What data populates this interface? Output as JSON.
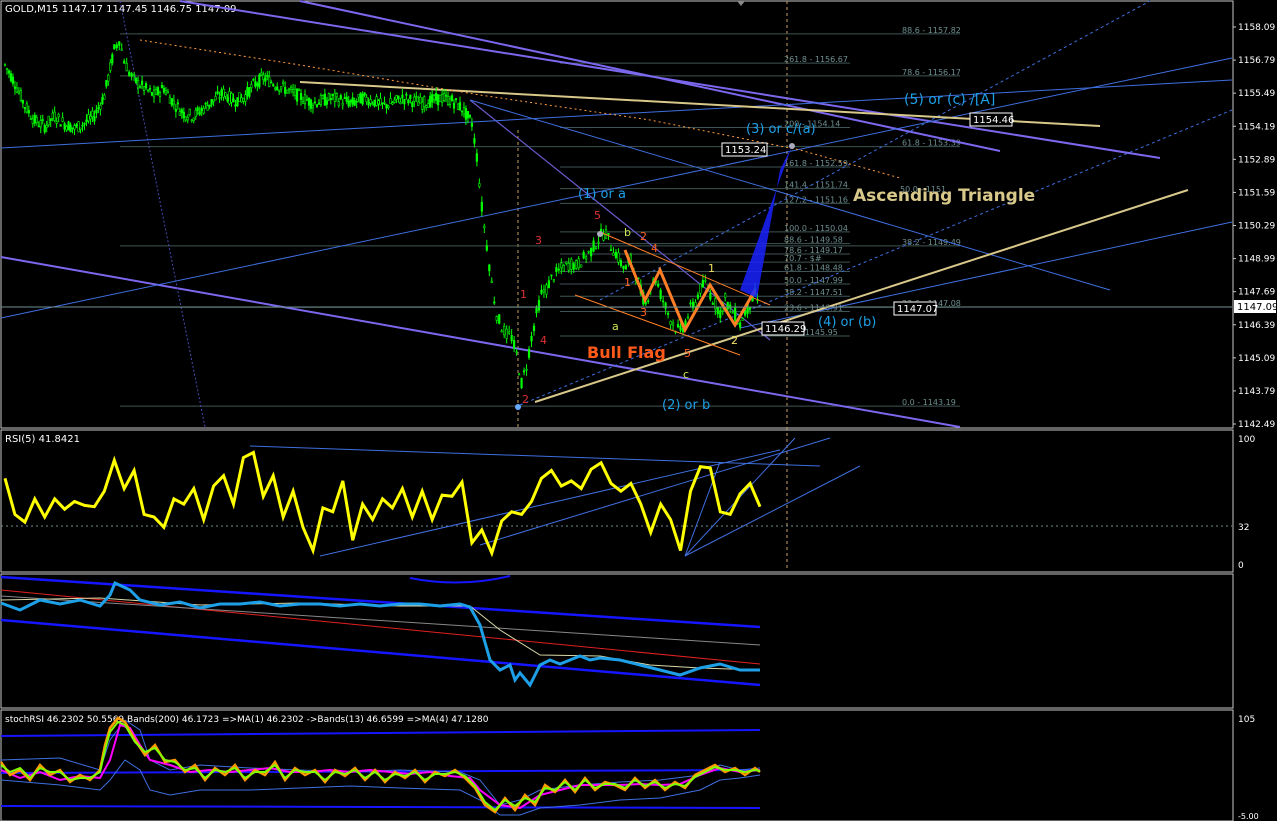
{
  "colors": {
    "background": "#000000",
    "frame": "#c8c8c8",
    "bull_candle": "#00ff00",
    "bear_candle": "#00ff00",
    "trend_purple": "#7b68ee",
    "channel_blue": "#3f6fe0",
    "wave_orange": "#ff7f27",
    "triangle_tan": "#d8c88a",
    "fib_grey": "#6f8f8f",
    "rsi_yellow": "#ffff00",
    "cyan_line": "#1ea0e8",
    "ma_red": "#e02020",
    "ma_white": "#d8d8a8",
    "stoch_magenta": "#ff00ff",
    "stoch_green": "#7fff00"
  },
  "main_panel": {
    "header": "GOLD,M15  1147.17 1147.45 1146.75 1147.09",
    "price_axis": [
      "1158.09",
      "1156.79",
      "1155.49",
      "1154.19",
      "1152.89",
      "1151.59",
      "1150.29",
      "1148.99",
      "1147.69",
      "1146.39",
      "1145.09",
      "1143.79",
      "1142.49"
    ],
    "current_price_tag": "1147.09",
    "ylim": [
      1142.49,
      1158.09
    ],
    "fib_right": [
      {
        "label": "88.6 - 1157.82",
        "value": 1157.82
      },
      {
        "label": "78.6 - 1156.17",
        "value": 1156.17
      },
      {
        "label": "61.8 - 1153.39",
        "value": 1153.39
      },
      {
        "label": "38.2 - 1149.49",
        "value": 1149.49
      },
      {
        "label": "23.6 - 1147.08",
        "value": 1147.08
      },
      {
        "label": "0.0 - 1143.19",
        "value": 1143.19
      }
    ],
    "fib_ext": [
      {
        "label": "261.8 - 1156.67",
        "value": 1156.67
      },
      {
        "label": "200 - 1154.14",
        "value": 1154.14
      },
      {
        "label": "161.8 - 1152.59",
        "value": 1152.59
      },
      {
        "label": "141.4 - 1151.74",
        "value": 1151.74
      },
      {
        "label": "127.2 - 1151.16",
        "value": 1151.16
      },
      {
        "label": "100.0 - 1150.04",
        "value": 1150.04
      },
      {
        "label": "88.6 - 1149.58",
        "value": 1149.58
      },
      {
        "label": "78.6 - 1149.17",
        "value": 1149.17
      },
      {
        "label": "70.7 - $#",
        "value": 1148.85
      },
      {
        "label": "61.8 - 1148.48",
        "value": 1148.48
      },
      {
        "label": "50.0 - 1147.99",
        "value": 1147.99
      },
      {
        "label": "38.2 - 1147.51",
        "value": 1147.51
      },
      {
        "label": "23.6 - 1146.91",
        "value": 1146.91
      },
      {
        "label": "0.0 - 1145.95",
        "value": 1145.95
      }
    ],
    "fib_mid_label": "50.0 - 1151",
    "price_boxes": {
      "p1153": "1153.24",
      "p1154": "1154.46",
      "p1146": "1146.29",
      "p1147": "1147.07"
    },
    "annotations": {
      "wave5ca": "(5) or (c) /[A]",
      "wave3ca": "(3) or c/(a)",
      "wave1a": "(1) or a",
      "wave4b": "(4) or (b)",
      "wave2b": "(2) or b",
      "asc_triangle": "Ascending Triangle",
      "bull_flag": "Bull Flag",
      "w1": "1",
      "w2": "2",
      "w3": "3",
      "w4": "4",
      "w5": "5",
      "a": "a",
      "b": "b",
      "c": "c",
      "o1": "1",
      "o2": "2",
      "o3": "3",
      "o4": "4",
      "o5": "5",
      "y1": "1",
      "y2": "2"
    }
  },
  "rsi_panel": {
    "header": "RSI(5) 41.8421",
    "axis": [
      "100",
      "32",
      "0"
    ],
    "ylim": [
      0,
      100
    ]
  },
  "stoch_panel": {
    "header": "stochRSI 46.2302 50.5569  Bands(200) 46.1723  =>MA(1) 46.2302  ->Bands(13) 46.6599  =>MA(4) 47.1280",
    "axis": [
      "105",
      "-5.00"
    ]
  },
  "chart_data": {
    "type": "line",
    "title": "GOLD,M15",
    "series": [
      {
        "name": "GOLD,M15",
        "x": [
          0,
          10,
          20,
          30,
          40,
          50,
          60,
          70,
          80,
          90,
          100,
          110,
          115,
          120,
          125,
          130,
          140,
          150,
          160,
          170,
          180,
          190,
          200,
          210,
          220,
          230,
          240,
          250,
          260,
          270,
          280,
          290,
          300,
          310,
          320,
          330,
          340,
          350,
          360,
          370,
          380,
          390,
          400,
          410,
          420,
          430,
          440,
          450,
          460,
          470,
          475,
          480,
          485,
          490,
          495,
          500,
          505,
          510,
          515,
          520,
          525,
          530,
          535,
          540,
          545,
          550,
          555,
          560,
          565,
          570,
          575,
          580,
          585,
          590,
          595,
          600,
          605,
          610,
          615,
          620,
          625,
          630,
          635,
          640,
          645,
          650,
          655,
          660,
          665,
          670,
          675,
          680,
          685,
          690,
          695,
          700,
          705,
          710,
          715,
          720,
          725,
          730,
          735,
          740,
          745,
          750,
          755,
          760
        ],
        "values": [
          1156.6,
          1155.9,
          1155.0,
          1154.4,
          1154.2,
          1154.6,
          1154.3,
          1154.1,
          1154.3,
          1154.6,
          1155.4,
          1157.2,
          1157.6,
          1156.8,
          1156.3,
          1156.0,
          1155.7,
          1155.4,
          1155.7,
          1155.1,
          1154.7,
          1154.6,
          1154.9,
          1155.2,
          1155.5,
          1155.2,
          1155.3,
          1155.8,
          1156.1,
          1155.9,
          1155.7,
          1155.5,
          1155.3,
          1155.1,
          1155.2,
          1155.3,
          1155.2,
          1155.1,
          1155.3,
          1155.2,
          1155.0,
          1155.1,
          1155.3,
          1155.2,
          1155.1,
          1155.2,
          1155.3,
          1155.2,
          1154.9,
          1154.3,
          1153.0,
          1151.0,
          1149.5,
          1148.0,
          1146.8,
          1146.3,
          1146.0,
          1145.9,
          1145.2,
          1144.1,
          1144.8,
          1145.9,
          1146.8,
          1147.6,
          1147.8,
          1148.2,
          1148.4,
          1148.6,
          1148.7,
          1148.8,
          1148.7,
          1148.9,
          1149.1,
          1149.3,
          1149.6,
          1149.9,
          1150.0,
          1149.5,
          1149.2,
          1148.8,
          1148.6,
          1148.9,
          1148.4,
          1147.7,
          1147.2,
          1147.9,
          1148.2,
          1147.6,
          1147.1,
          1146.6,
          1146.3,
          1146.1,
          1146.5,
          1147.0,
          1147.3,
          1147.8,
          1148.0,
          1147.6,
          1147.2,
          1146.9,
          1147.4,
          1147.0,
          1146.8,
          1146.4,
          1146.9,
          1147.2,
          1147.6,
          1147.1
        ]
      },
      {
        "name": "RSI(5)",
        "x": [
          0,
          10,
          20,
          30,
          40,
          50,
          60,
          70,
          80,
          90,
          100,
          110,
          120,
          130,
          140,
          150,
          160,
          170,
          180,
          190,
          200,
          210,
          220,
          230,
          240,
          250,
          260,
          270,
          280,
          290,
          300,
          310,
          320,
          330,
          340,
          350,
          360,
          370,
          380,
          390,
          400,
          410,
          420,
          430,
          440,
          450,
          460,
          470,
          480,
          490,
          500,
          510,
          520,
          530,
          540,
          550,
          560,
          570,
          580,
          590,
          600,
          610,
          620,
          630,
          640,
          650,
          660,
          670,
          680,
          690,
          700,
          710,
          720,
          730,
          740,
          750,
          760
        ],
        "values": [
          68,
          40,
          34,
          52,
          38,
          52,
          44,
          50,
          47,
          46,
          58,
          82,
          60,
          74,
          40,
          38,
          30,
          52,
          48,
          60,
          36,
          62,
          70,
          48,
          84,
          88,
          54,
          70,
          38,
          58,
          30,
          12,
          45,
          42,
          66,
          20,
          48,
          36,
          52,
          45,
          60,
          38,
          58,
          36,
          55,
          54,
          65,
          18,
          28,
          10,
          35,
          42,
          40,
          50,
          68,
          74,
          62,
          66,
          60,
          75,
          80,
          64,
          58,
          64,
          48,
          26,
          48,
          36,
          12,
          58,
          77,
          76,
          42,
          40,
          56,
          64,
          46
        ]
      }
    ],
    "xlabel": "",
    "ylabel": "",
    "ylim": [
      1142.49,
      1158.09
    ],
    "grid": false,
    "legend": "none"
  }
}
